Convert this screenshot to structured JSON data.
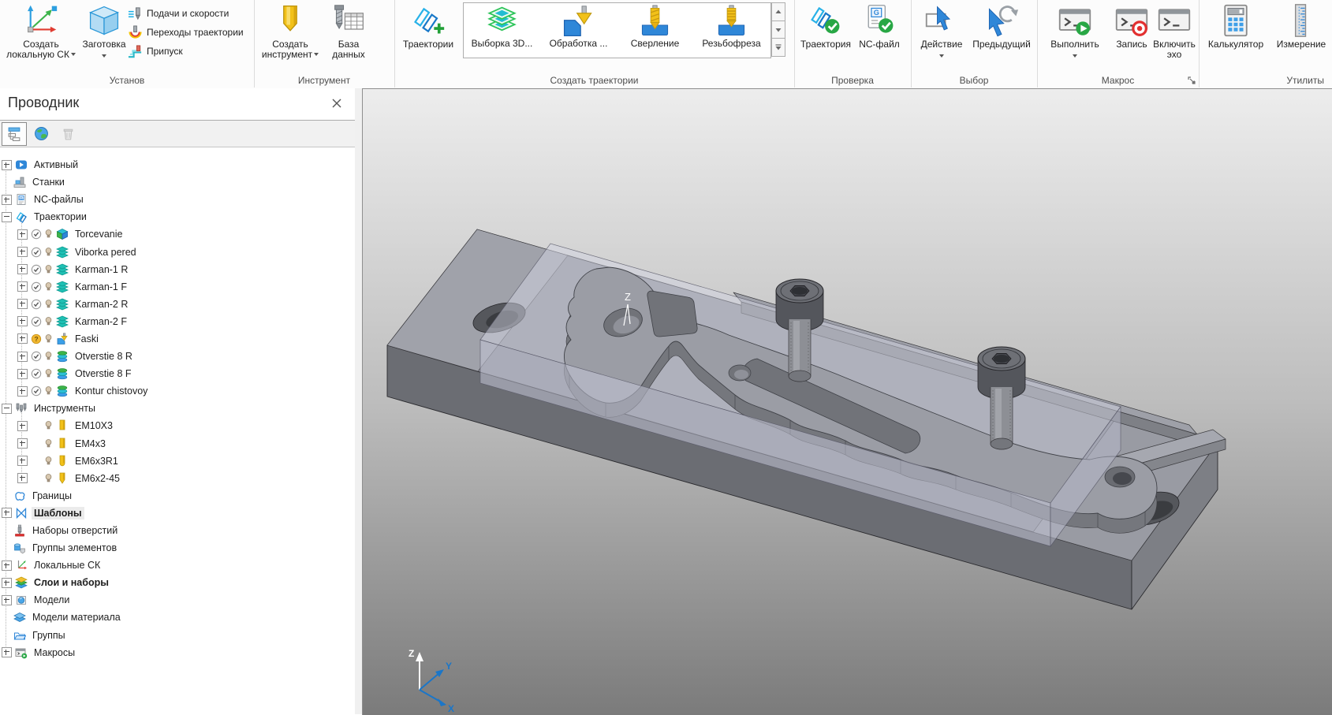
{
  "ribbon": {
    "groups": [
      {
        "label": "Установ",
        "items": [
          {
            "label": "Создать локальную СК",
            "dropdown": true,
            "icon": "local-cs"
          },
          {
            "label": "Заготовка",
            "dropdown": true,
            "icon": "stock-block"
          },
          {
            "label": "Подачи и скорости",
            "icon": "feeds-speeds"
          },
          {
            "label": "Переходы траектории",
            "icon": "toolpath-links"
          },
          {
            "label": "Припуск",
            "icon": "thickness"
          }
        ]
      },
      {
        "label": "Инструмент",
        "items": [
          {
            "label": "Создать инструмент",
            "dropdown": true,
            "icon": "create-tool"
          },
          {
            "label": "База данных",
            "icon": "tool-database"
          }
        ]
      },
      {
        "label": "Создать траектории",
        "items": [
          {
            "label": "Траектории",
            "icon": "toolpaths-plus"
          }
        ],
        "gallery": [
          {
            "label": "Выборка 3D...",
            "icon": "3d-area-clearance"
          },
          {
            "label": "Обработка ...",
            "icon": "chamfer-machining"
          },
          {
            "label": "Сверление",
            "icon": "drilling"
          },
          {
            "label": "Резьбофреза",
            "icon": "thread-milling"
          }
        ]
      },
      {
        "label": "Проверка",
        "items": [
          {
            "label": "Траектория",
            "icon": "verify-toolpath"
          },
          {
            "label": "NC-файл",
            "icon": "verify-nc-file"
          }
        ]
      },
      {
        "label": "Выбор",
        "items": [
          {
            "label": "Действие",
            "dropdown": true,
            "icon": "select-action"
          },
          {
            "label": "Предыдущий",
            "icon": "select-previous"
          }
        ]
      },
      {
        "label": "Макрос",
        "items": [
          {
            "label": "Выполнить",
            "dropdown": true,
            "icon": "macro-run"
          },
          {
            "label": "Запись",
            "icon": "macro-record"
          },
          {
            "label": "Включить эхо",
            "icon": "macro-echo"
          }
        ],
        "dialog_launcher": true
      },
      {
        "label": "Утилиты",
        "items": [
          {
            "label": "Калькулятор",
            "icon": "calculator"
          },
          {
            "label": "Измерение",
            "icon": "measure"
          }
        ]
      }
    ]
  },
  "explorer": {
    "title": "Проводник",
    "toolbar_icons": [
      "tree-view",
      "world",
      "trash"
    ],
    "tree": [
      {
        "label": "Активный",
        "icon": "active",
        "expander": "plus"
      },
      {
        "label": "Станки",
        "icon": "machines"
      },
      {
        "label": "NC-файлы",
        "icon": "nc-files",
        "expander": "plus"
      },
      {
        "label": "Траектории",
        "icon": "toolpaths",
        "expander": "minus"
      },
      {
        "label": "Torcevanie",
        "icon": "block-toolpath",
        "expander": "plus",
        "check": "check",
        "b": true
      },
      {
        "label": "Viborka pered",
        "icon": "layers-toolpath",
        "expander": "plus",
        "check": "check",
        "b": true
      },
      {
        "label": "Karman-1 R",
        "icon": "layers-toolpath",
        "expander": "plus",
        "check": "check",
        "b": true
      },
      {
        "label": "Karman-1 F",
        "icon": "layers-toolpath",
        "expander": "plus",
        "check": "check",
        "b": true
      },
      {
        "label": "Karman-2 R",
        "icon": "layers-toolpath",
        "expander": "plus",
        "check": "check",
        "b": true
      },
      {
        "label": "Karman-2 F",
        "icon": "layers-toolpath",
        "expander": "plus",
        "check": "check",
        "b": true
      },
      {
        "label": "Faski",
        "icon": "chamfer-toolpath",
        "expander": "plus",
        "check": "question",
        "b": true
      },
      {
        "label": "Otverstie 8 R",
        "icon": "drill-toolpath",
        "expander": "plus",
        "check": "check",
        "b": true
      },
      {
        "label": "Otverstie 8 F",
        "icon": "drill-toolpath",
        "expander": "plus",
        "check": "check",
        "b": true
      },
      {
        "label": "Kontur chistovoy",
        "icon": "drill-toolpath",
        "expander": "plus",
        "check": "check",
        "b": true
      },
      {
        "label": "Инструменты",
        "icon": "tools",
        "expander": "minus"
      },
      {
        "label": "EM10X3",
        "icon": "endmill",
        "expander": "plus",
        "b": true
      },
      {
        "label": "EM4x3",
        "icon": "endmill",
        "expander": "plus",
        "b": true
      },
      {
        "label": "EM6x3R1",
        "icon": "ballnose",
        "expander": "plus",
        "b": true
      },
      {
        "label": "EM6x2-45",
        "icon": "chamfermill",
        "expander": "plus",
        "b": true
      },
      {
        "label": "Границы",
        "icon": "boundaries"
      },
      {
        "label": "Шаблоны",
        "icon": "patterns",
        "expander": "plus",
        "bold": true,
        "selected": true
      },
      {
        "label": "Наборы отверстий",
        "icon": "hole-sets"
      },
      {
        "label": "Группы элементов",
        "icon": "feature-groups"
      },
      {
        "label": "Локальные СК",
        "icon": "local-cs",
        "expander": "plus"
      },
      {
        "label": "Слои и наборы",
        "icon": "levels-sets",
        "expander": "plus",
        "bold": true
      },
      {
        "label": "Модели",
        "icon": "models",
        "expander": "plus"
      },
      {
        "label": "Модели материала",
        "icon": "stock-models"
      },
      {
        "label": "Группы",
        "icon": "groups"
      },
      {
        "label": "Макросы",
        "icon": "macros",
        "expander": "plus"
      }
    ]
  },
  "viewport": {
    "part_axis_label": "Z",
    "triad": {
      "x": "X",
      "y": "Y",
      "z": "Z"
    }
  },
  "colors": {
    "accent_blue": "#2f87d8",
    "toolpath_cyan": "#28b2e8",
    "tool_yellow": "#f2c118",
    "check_green": "#28a745",
    "record_red": "#e23030",
    "viewport_top": "#ededed",
    "viewport_bottom": "#7b7b7b",
    "plate_gray": "#8d8f97",
    "part_gray": "#9b9da5"
  }
}
